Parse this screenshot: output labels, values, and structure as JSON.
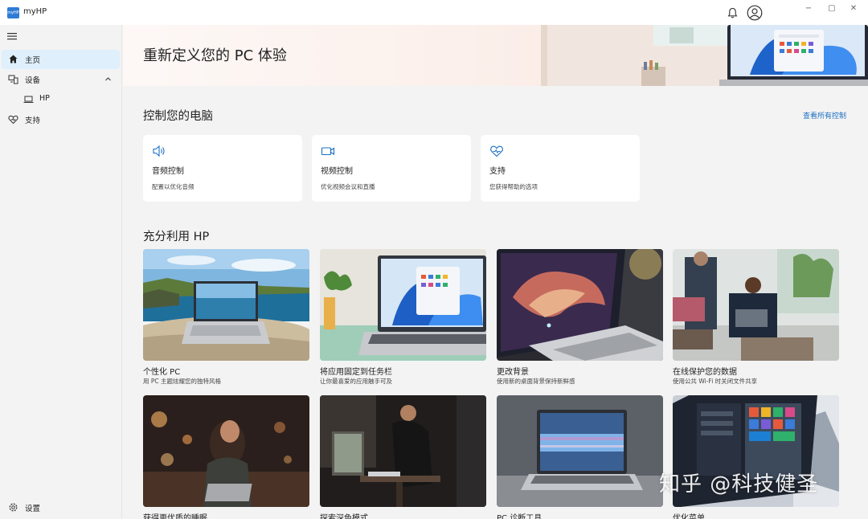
{
  "app": {
    "logo_text": "myHP",
    "title": "myHP"
  },
  "window_controls": {
    "minimize": "−",
    "maximize": "▢",
    "close": "✕"
  },
  "sidebar": {
    "items": [
      {
        "label": "主页",
        "icon": "home-icon"
      },
      {
        "label": "设备",
        "icon": "devices-icon"
      },
      {
        "label": "HP",
        "icon": "laptop-icon"
      },
      {
        "label": "支持",
        "icon": "support-heart-icon"
      }
    ],
    "settings_label": "设置"
  },
  "hero": {
    "title": "重新定义您的 PC 体验"
  },
  "control": {
    "title": "控制您的电脑",
    "view_all": "查看所有控制",
    "cards": [
      {
        "title": "音频控制",
        "desc": "配置以优化音频",
        "icon": "speaker-icon"
      },
      {
        "title": "视频控制",
        "desc": "优化视频会议和直播",
        "icon": "video-camera-icon"
      },
      {
        "title": "支持",
        "desc": "您获得帮助的选项",
        "icon": "support-heart-icon"
      }
    ]
  },
  "make_most": {
    "title": "充分利用 HP",
    "tiles": [
      {
        "title": "个性化 PC",
        "desc": "用 PC 主题炫耀您的独特风格"
      },
      {
        "title": "将应用固定到任务栏",
        "desc": "让你最喜爱的应用触手可及"
      },
      {
        "title": "更改背景",
        "desc": "使用新的桌面背景保持新鲜感"
      },
      {
        "title": "在线保护您的数据",
        "desc": "使用公共 Wi-Fi 时关闭文件共享"
      },
      {
        "title": "获得更优质的睡眠",
        "desc": ""
      },
      {
        "title": "探索深色模式",
        "desc": ""
      },
      {
        "title": "PC 诊断工具",
        "desc": ""
      },
      {
        "title": "优化菜单",
        "desc": ""
      }
    ]
  },
  "watermark": "知乎 @科技健圣",
  "colors": {
    "accent": "#1a6fc1",
    "active_nav": "#dfeffb",
    "background": "#f3f3f3"
  }
}
